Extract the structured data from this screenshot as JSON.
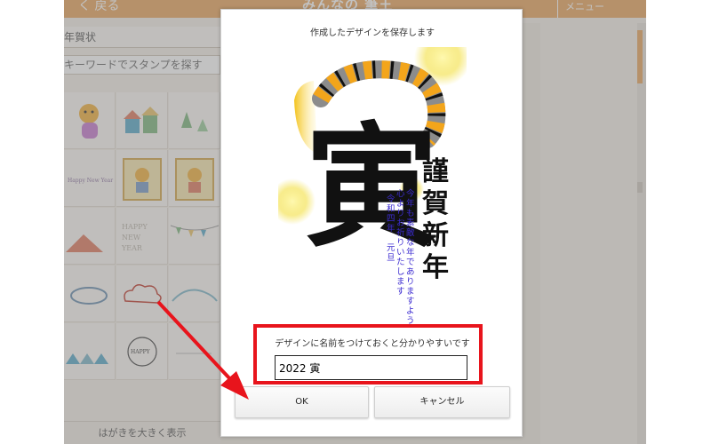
{
  "app": {
    "back_label": "く 戻る",
    "logo": "みんなの 筆王",
    "menu_label": "メニュー",
    "category": "年賀状",
    "search_placeholder": "キーワードでスタンプを探す",
    "enlarge_label": "はがきを大きく表示"
  },
  "modal": {
    "title": "作成したデザインを保存します",
    "name_hint": "デザインに名前をつけておくと分かりやすいです",
    "name_value": "2022 寅",
    "ok_label": "OK",
    "cancel_label": "キャンセル"
  },
  "card": {
    "kanji": "寅",
    "greeting": "謹賀新年",
    "line1": "今年も素敵な年でありますよう",
    "line2": "心よりお祈りいたします",
    "line3": "令和四年　元旦"
  },
  "colors": {
    "header": "#e9a75f",
    "highlight": "#e8141c",
    "arrow": "#e8141c",
    "message_text": "#3b2bd0",
    "stripe_gray": "#8c8c8c",
    "stripe_orange": "#f3a51b"
  }
}
